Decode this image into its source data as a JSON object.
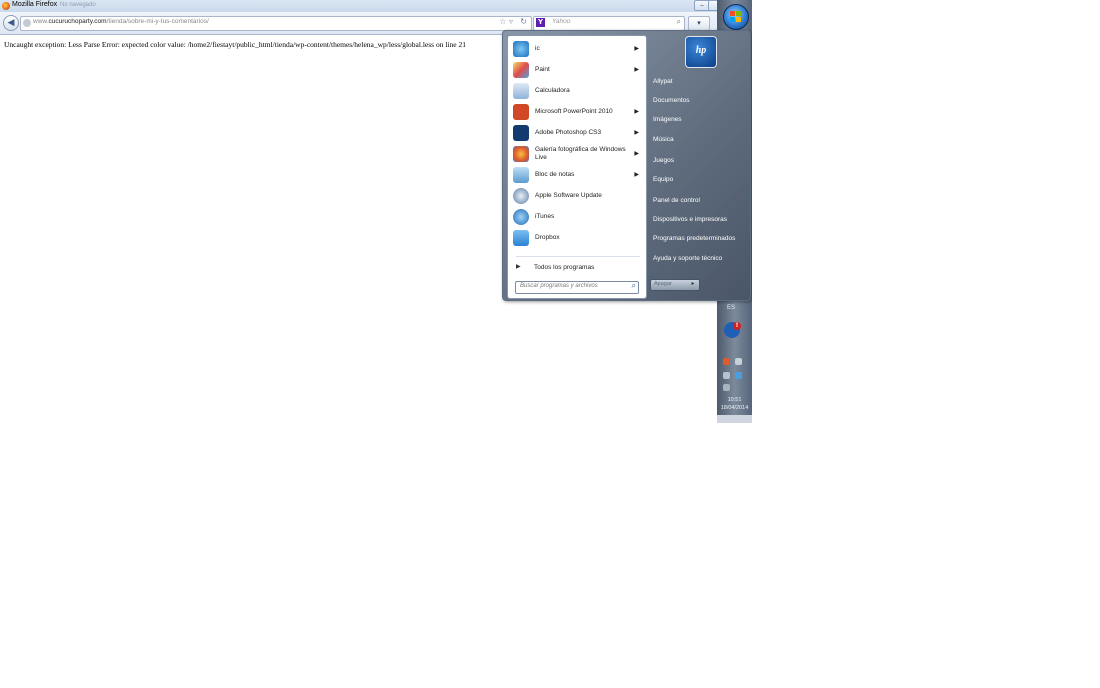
{
  "window": {
    "title": "Mozilla Firefox",
    "tab_label": "No navegado",
    "btn_min": "‒"
  },
  "navbar": {
    "url_prefix": "www.",
    "url_domain": "cucuruchoparty.com",
    "url_path": "/tienda/sobre-mi-y-tus-comentarios/",
    "search_placeholder": "Yahoo",
    "search_engine_letter": "Y",
    "menu_label": "▾"
  },
  "page": {
    "error": "Uncaught exception: Less Parse Error: expected color value: /home2/fiestayt/public_html/tienda/wp-content/themes/helena_wp/less/global.less on line 21"
  },
  "start_menu": {
    "programs": [
      {
        "label": "ic",
        "icon": "ie-icon",
        "arrow": true
      },
      {
        "label": "Paint",
        "icon": "paint-icon",
        "arrow": true
      },
      {
        "label": "Calculadora",
        "icon": "calculator-icon",
        "arrow": false
      },
      {
        "label": "Microsoft PowerPoint 2010",
        "icon": "powerpoint-icon",
        "arrow": true
      },
      {
        "label": "Adobe Photoshop CS3",
        "icon": "photoshop-icon",
        "arrow": true
      },
      {
        "label": "Galería fotográfica de Windows Live",
        "icon": "photo-gallery-icon",
        "arrow": true
      },
      {
        "label": "Bloc de notas",
        "icon": "notepad-icon",
        "arrow": true
      },
      {
        "label": "Apple Software Update",
        "icon": "apple-update-icon",
        "arrow": false
      },
      {
        "label": "iTunes",
        "icon": "itunes-icon",
        "arrow": false
      },
      {
        "label": "Dropbox",
        "icon": "dropbox-icon",
        "arrow": false
      }
    ],
    "all_programs": "Todos los programas",
    "search_placeholder": "Buscar programas y archivos",
    "user_tile_text": "hp",
    "right_links": [
      "Allypat",
      "Documentos",
      "Imágenes",
      "Música",
      "Juegos",
      "Equipo",
      "Panel de control",
      "Dispositivos e impresoras",
      "Programas predeterminados",
      "Ayuda y soporte técnico"
    ],
    "shutdown_label": "Apagar",
    "shutdown_arrow": "▸"
  },
  "taskbar": {
    "language": "ES",
    "time": "10:51",
    "date": "18/04/2014",
    "alert_badge": "!"
  },
  "colors": {
    "accent": "#2d7bd2",
    "taskbar": "#5f6c7e"
  }
}
